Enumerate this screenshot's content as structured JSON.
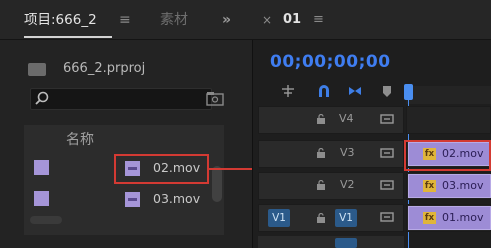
{
  "project_panel": {
    "tab_project_label": "项目:666_2",
    "tab_project_menu": "≡",
    "tab_media_label": "素材",
    "tab_overflow": "»",
    "project_file": "666_2.prproj",
    "search": {
      "placeholder": "",
      "value": ""
    },
    "column_name": "名称",
    "items": [
      {
        "label": "02.mov"
      },
      {
        "label": "03.mov"
      }
    ]
  },
  "timeline_panel": {
    "close_glyph": "×",
    "sequence_title": "01",
    "menu_glyph": "≡",
    "timecode": "00;00;00;00",
    "playhead_color": "#4a8ef0",
    "tracks": [
      {
        "label": "V4",
        "source": "",
        "clip": ""
      },
      {
        "label": "V3",
        "source": "",
        "clip": "02.mov"
      },
      {
        "label": "V2",
        "source": "",
        "clip": "03.mov"
      },
      {
        "label": "V1",
        "source": "V1",
        "clip": "01.mov"
      }
    ],
    "fx_label": "fx"
  },
  "colors": {
    "accent_timecode": "#3f7df0",
    "clip_purple": "#9d8cd6",
    "highlight_red": "#d33a33",
    "target_blue": "#2b5a8a",
    "fx_yellow": "#e0b53a"
  }
}
